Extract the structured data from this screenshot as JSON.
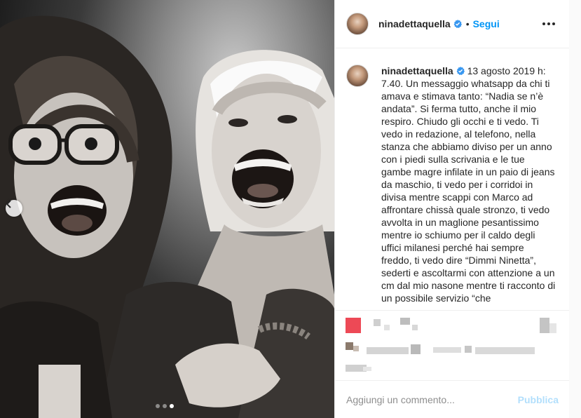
{
  "post": {
    "username": "ninadettaquella",
    "separator": "•",
    "follow_label": "Segui",
    "caption_username": "ninadettaquella",
    "caption_body": " 13 agosto 2019 h: 7.40. Un messaggio whatsapp da chi ti amava e stimava tanto: “Nadia se n’è andata”. Si ferma tutto, anche il mio respiro. Chiudo gli occhi e ti vedo. Ti vedo in redazione, al telefono, nella stanza che abbiamo diviso per un anno con i piedi sulla scrivania e le tue gambe magre infilate in un paio di jeans da maschio, ti vedo per i corridoi in divisa mentre scappi con Marco ad affrontare chissà quale stronzo, ti vedo avvolta in un maglione pesantissimo mentre io schiumo per il caldo degli uffici milanesi perché hai sempre freddo, ti vedo dire “Dimmi Ninetta”, sederti e ascoltarmi con attenzione a un cm dal mio nasone mentre ti racconto di un possibile servizio “che",
    "carousel": {
      "slides": 3,
      "active_index": 2
    }
  },
  "comment": {
    "placeholder": "Aggiungi un commento...",
    "publish_label": "Pubblica"
  },
  "colors": {
    "accent": "#0095f6",
    "verified": "#3897f0",
    "like_red": "#ed4956",
    "publish_disabled": "#b2dffc",
    "border": "#efefef"
  },
  "icons": {
    "verified": "verified-badge-icon",
    "more": "more-options-icon",
    "prev": "chevron-left-icon"
  }
}
